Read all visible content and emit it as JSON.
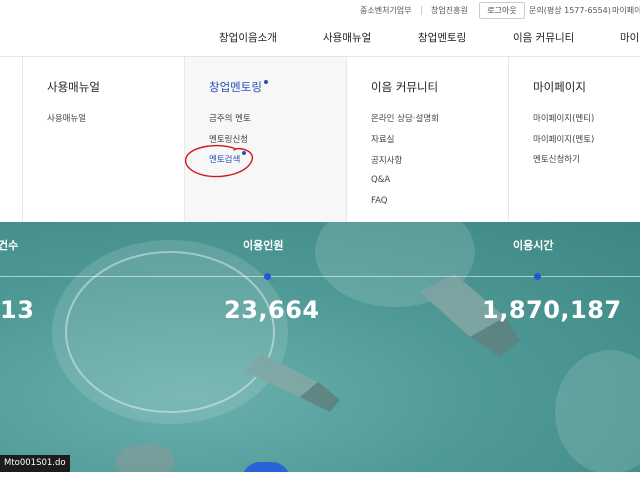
{
  "util_links": {
    "ministry": "중소벤처기업부",
    "agency": "창업진흥원",
    "logout": "로그아웃",
    "inquiry": "문의(평상 1577-6554)",
    "mypage": "마이페이"
  },
  "gnb": {
    "intro": "창업이음소개",
    "manual": "사용매뉴얼",
    "mentoring": "창업멘토링",
    "community": "이음 커뮤니티",
    "mypage": "마이"
  },
  "menu": {
    "manual": {
      "title": "사용매뉴얼",
      "items": [
        "사용매뉴얼"
      ]
    },
    "mentoring": {
      "title": "창업멘토링",
      "items": [
        "금주의 멘토",
        "멘토링신청",
        "멘토검색"
      ]
    },
    "community": {
      "title": "이음 커뮤니티",
      "items": [
        "온라인 상담·설명회",
        "자료실",
        "공지사항",
        "Q&A",
        "FAQ"
      ]
    },
    "mypage": {
      "title": "마이페이지",
      "items": [
        "마이페이지(멘티)",
        "마이페이지(멘토)",
        "멘토신청하기"
      ]
    }
  },
  "stats": [
    {
      "label": "건수",
      "value": "13"
    },
    {
      "label": "이용인원",
      "value": "23,664"
    },
    {
      "label": "이용시간",
      "value": "1,870,187"
    }
  ],
  "status_url": "Mto001S01.do",
  "colors": {
    "accent": "#2a4fb6",
    "hero": "#4f9a97",
    "annotation": "#d0181a"
  }
}
